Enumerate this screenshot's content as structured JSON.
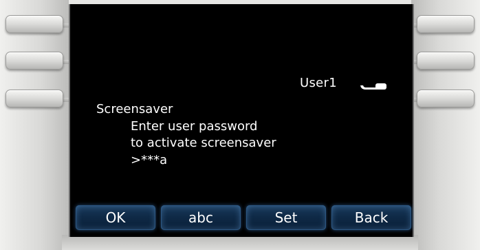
{
  "status": {
    "user": "User1",
    "handset_icon": "handset-icon"
  },
  "prompt": {
    "title": "Screensaver",
    "line1": "Enter user password",
    "line2": "to activate screensaver",
    "input": ">***a"
  },
  "softkeys": [
    "OK",
    "abc",
    "Set",
    "Back"
  ],
  "colors": {
    "screen_bg": "#000000",
    "text": "#ffffff",
    "softkey": "#0f2a47",
    "bezel": "#d6d6d4"
  }
}
